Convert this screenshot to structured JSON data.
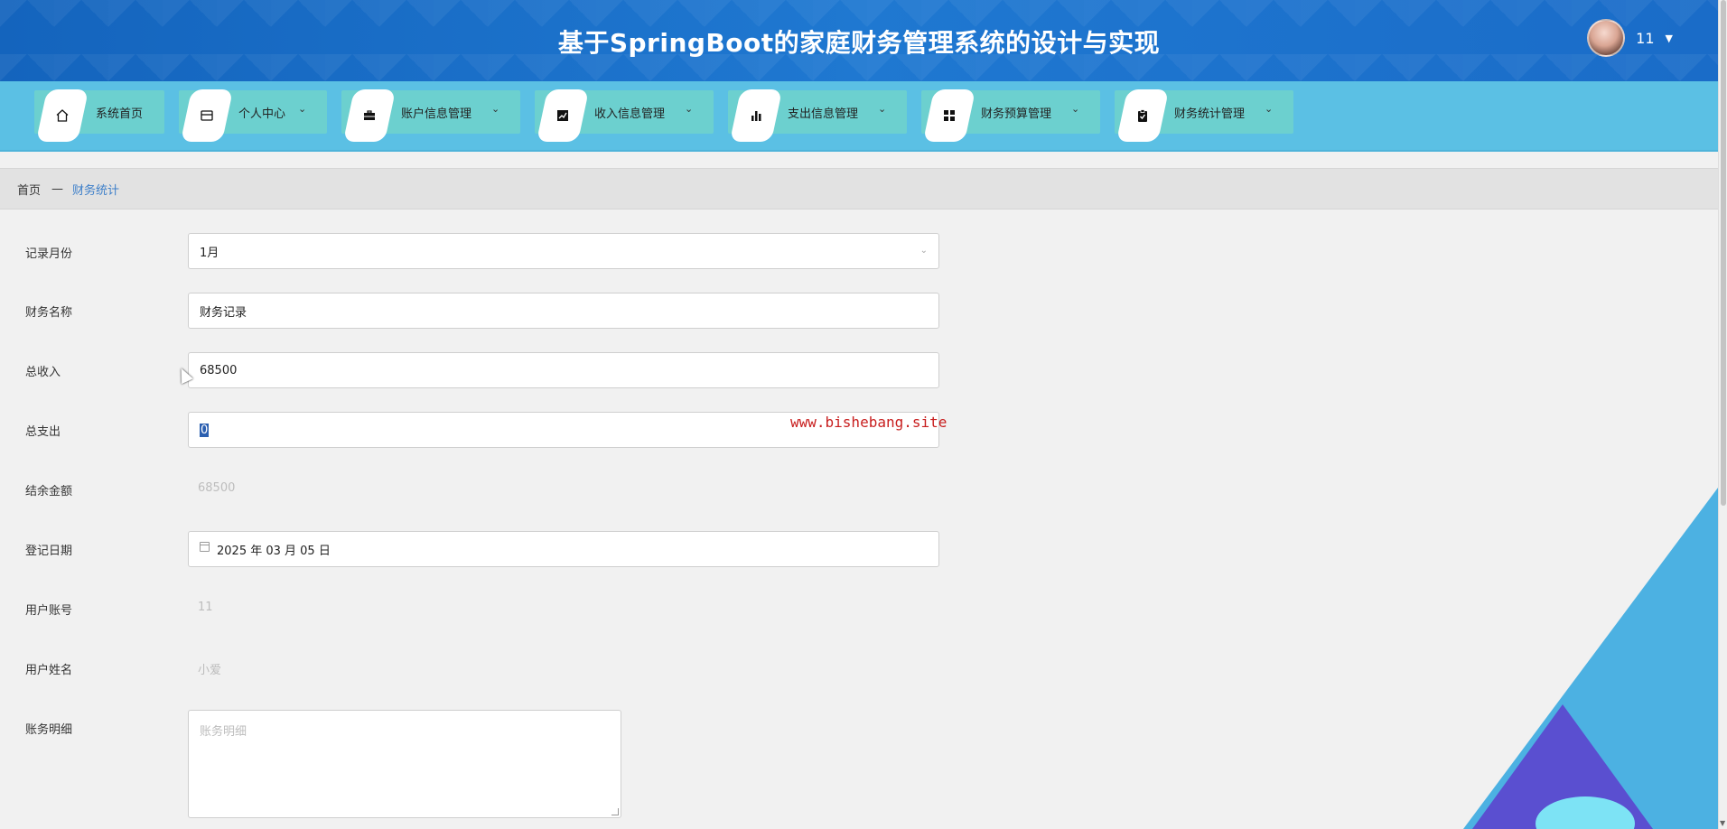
{
  "header": {
    "title": "基于SpringBoot的家庭财务管理系统的设计与实现",
    "user": "11"
  },
  "nav": {
    "items": [
      {
        "label": "系统首页",
        "icon": "home-icon"
      },
      {
        "label": "个人中心",
        "icon": "id-card-icon"
      },
      {
        "label": "账户信息管理",
        "icon": "briefcase-icon"
      },
      {
        "label": "收入信息管理",
        "icon": "trend-chart-icon"
      },
      {
        "label": "支出信息管理",
        "icon": "bar-chart-icon"
      },
      {
        "label": "财务预算管理",
        "icon": "grid-icon"
      },
      {
        "label": "财务统计管理",
        "icon": "clipboard-check-icon"
      }
    ]
  },
  "breadcrumb": {
    "home": "首页",
    "separator": "—",
    "current": "财务统计"
  },
  "form": {
    "month": {
      "label": "记录月份",
      "value": "1月"
    },
    "name": {
      "label": "财务名称",
      "value": "财务记录"
    },
    "income": {
      "label": "总收入",
      "value": "68500"
    },
    "expense": {
      "label": "总支出",
      "value": "0"
    },
    "balance": {
      "label": "结余金额",
      "value": "68500"
    },
    "date": {
      "label": "登记日期",
      "value": "2025 年 03 月 05 日"
    },
    "account": {
      "label": "用户账号",
      "value": "11"
    },
    "username": {
      "label": "用户姓名",
      "value": "小爱"
    },
    "detail": {
      "label": "账务明细",
      "placeholder": "账务明细"
    }
  },
  "watermark": "www.bishebang.site",
  "colors": {
    "header": "#1a6cc8",
    "nav": "#5bc0e4",
    "nav_item": "#6cd0cf",
    "link": "#3d7fc9",
    "watermark": "#c81e1e"
  }
}
